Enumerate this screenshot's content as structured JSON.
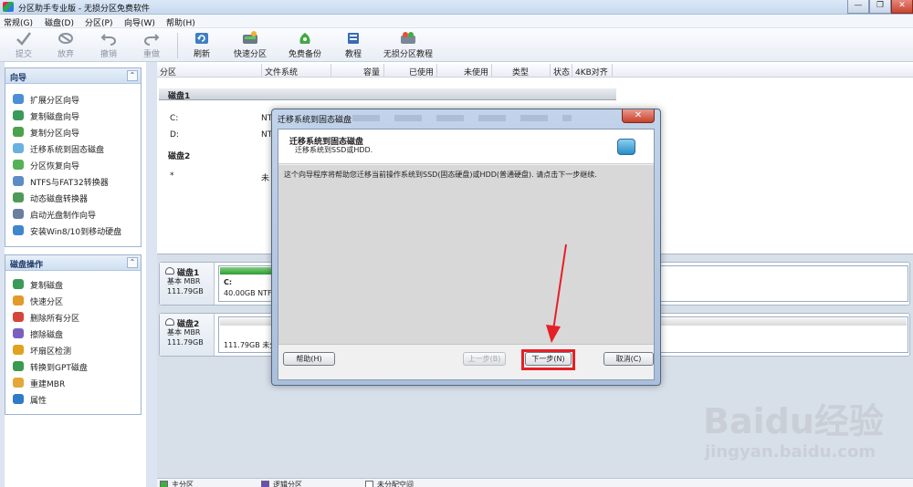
{
  "window": {
    "title": "分区助手专业版 - 无损分区免费软件",
    "minimize": "—",
    "restore": "❐",
    "close": "✕"
  },
  "menu": [
    "常规(G)",
    "磁盘(D)",
    "分区(P)",
    "向导(W)",
    "帮助(H)"
  ],
  "toolbar": [
    {
      "label": "提交",
      "icon": "commit-check-icon",
      "disabled": true
    },
    {
      "label": "放弃",
      "icon": "discard-icon",
      "disabled": true
    },
    {
      "label": "撤销",
      "icon": "undo-icon",
      "disabled": true
    },
    {
      "label": "重做",
      "icon": "redo-icon",
      "disabled": true
    },
    {
      "label": "刷新",
      "icon": "refresh-icon",
      "disabled": false
    },
    {
      "label": "快速分区",
      "icon": "quick-partition-icon",
      "disabled": false
    },
    {
      "label": "免费备份",
      "icon": "free-backup-icon",
      "disabled": false
    },
    {
      "label": "教程",
      "icon": "tutorial-icon",
      "disabled": false
    },
    {
      "label": "无损分区教程",
      "icon": "lossless-tutorial-icon",
      "disabled": false
    }
  ],
  "wizard_panel": {
    "title": "向导",
    "collapse": "⌃",
    "items": [
      "扩展分区向导",
      "复制磁盘向导",
      "复制分区向导",
      "迁移系统到固态磁盘",
      "分区恢复向导",
      "NTFS与FAT32转换器",
      "动态磁盘转换器",
      "启动光盘制作向导",
      "安装Win8/10到移动硬盘"
    ]
  },
  "disk_ops_panel": {
    "title": "磁盘操作",
    "collapse": "⌃",
    "items": [
      "复制磁盘",
      "快速分区",
      "删除所有分区",
      "擦除磁盘",
      "坏扇区检测",
      "转换到GPT磁盘",
      "重建MBR",
      "属性"
    ]
  },
  "table": {
    "columns": [
      "分区",
      "文件系统",
      "容量",
      "已使用",
      "未使用",
      "类型",
      "状态",
      "4KB对齐"
    ],
    "disk1_label": "磁盘1",
    "disk2_label": "磁盘2",
    "rows": [
      {
        "partition": "C:",
        "fs": "NT"
      },
      {
        "partition": "D:",
        "fs": "NT"
      },
      {
        "partition": "*",
        "fs": "未"
      }
    ]
  },
  "disk_map": [
    {
      "name": "磁盘1",
      "type": "基本 MBR",
      "size": "111.79GB",
      "part_label": "C:",
      "part_desc": "40.00GB NTFS",
      "used_fraction": 1.0
    },
    {
      "name": "磁盘2",
      "type": "基本 MBR",
      "size": "111.79GB",
      "part_label": "",
      "part_desc": "111.79GB 未分",
      "used_fraction": 0.0
    }
  ],
  "legend": [
    "主分区",
    "逻辑分区",
    "未分配空间"
  ],
  "dialog": {
    "title": "迁移系统到固态磁盘",
    "header_title": "迁移系统到固态磁盘",
    "header_subtitle": "迁移系统到SSD或HDD.",
    "message": "这个向导程序将帮助您迁移当前操作系统到SSD(固态硬盘)或HDD(普通硬盘). 请点击下一步继续.",
    "help_button": "帮助(H)",
    "back_button": "上一步(B)",
    "next_button": "下一步(N)",
    "cancel_button": "取消(C)",
    "close": "✕"
  },
  "watermark": {
    "brand": "Baidu经验",
    "url": "jingyan.baidu.com"
  },
  "colors": {
    "highlight_red": "#e61f26",
    "primary_partition_green": "#3fae3f",
    "logical_partition_purple": "#6a4fb3"
  }
}
